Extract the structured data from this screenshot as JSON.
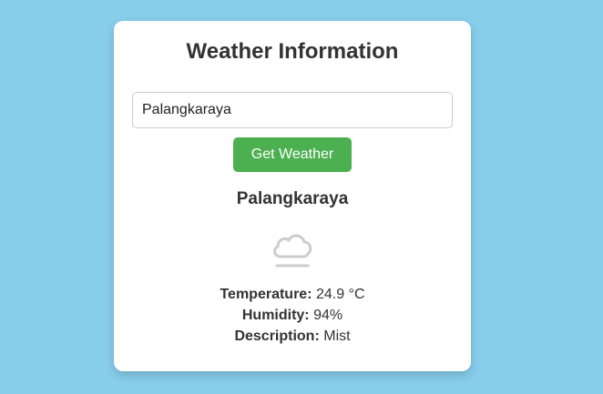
{
  "app": {
    "title": "Weather Information"
  },
  "search": {
    "value": "Palangkaraya"
  },
  "actions": {
    "get_weather_label": "Get Weather"
  },
  "result": {
    "city": "Palangkaraya",
    "icon": "mist-cloud-icon",
    "temperature_label": "Temperature:",
    "temperature_value": "24.9 °C",
    "humidity_label": "Humidity:",
    "humidity_value": "94%",
    "description_label": "Description:",
    "description_value": "Mist"
  },
  "colors": {
    "background": "#87ceeb",
    "button": "#4caf50",
    "card": "#ffffff",
    "text": "#333333"
  }
}
